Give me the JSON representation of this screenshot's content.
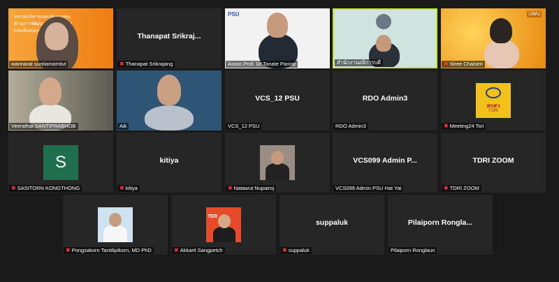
{
  "tiles": {
    "wannarat": {
      "name": "wannarat suntiamorntut",
      "overlay": "หน่วยบริหารและจัดการทุน ด้านการพัฒนาระดับ ในการแข่งขันของประเทศ (บพข.)"
    },
    "thanapat": {
      "name": "Thanapat Srikrajang",
      "center": "Thanapat Srikraj..."
    },
    "tanate": {
      "name": "Assoc.Prof. Dr Tanate Panrat",
      "brand": "PSU"
    },
    "office": {
      "name": "สำนักงานอธิการบดี"
    },
    "siree": {
      "name": "Siree Chaiseri",
      "brand": "UWU"
    },
    "veerathai": {
      "name": "Veerathai SANTIPRABHOB"
    },
    "aik": {
      "name": "Aik"
    },
    "vcs12": {
      "name": "VCS_12 PSU",
      "center": "VCS_12 PSU"
    },
    "rdo": {
      "name": "RDO Admin3",
      "center": "RDO Admin3"
    },
    "meeting24": {
      "name": "Meeting24 Tsri",
      "logo": "สกสว",
      "logo_sub": "TSRI"
    },
    "sasitorn": {
      "name": "SASITORN KONGTHONG",
      "letter": "S"
    },
    "kitiya": {
      "name": "kitiya",
      "center": "kitiya"
    },
    "natawut": {
      "name": "Natawut Nupairoj"
    },
    "vcs099": {
      "name": "VCS099 Admin PSU Hat Yai",
      "center": "VCS099 Admin P..."
    },
    "tdri": {
      "name": "TDRI ZOOM",
      "center": "TDRI ZOOM"
    },
    "pongsakorn": {
      "name": "Pongsakorn Tantilipikorn, MD PhD"
    },
    "akkarit": {
      "name": "Akkarit Sangpetch",
      "overlay": "TER"
    },
    "suppaluk": {
      "name": "suppaluk",
      "center": "suppaluk"
    },
    "pilaiporn": {
      "name": "Pilaiporn Ronglaun",
      "center": "Pilaiporn Rongla..."
    }
  },
  "colors": {
    "active_speaker_border": "#c6e82a",
    "muted_icon": "#ff3b3b",
    "tile_bg": "#262626"
  },
  "icons": {
    "muted": "mic-muted-icon"
  }
}
